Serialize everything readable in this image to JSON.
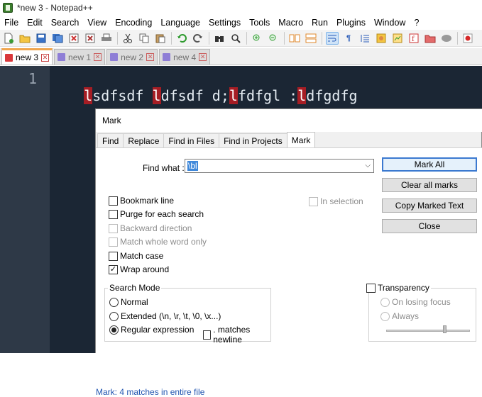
{
  "window": {
    "title": "*new 3 - Notepad++"
  },
  "menu": [
    "File",
    "Edit",
    "Search",
    "View",
    "Encoding",
    "Language",
    "Settings",
    "Tools",
    "Macro",
    "Run",
    "Plugins",
    "Window",
    "?"
  ],
  "tabs": [
    {
      "label": "new 3",
      "active": true
    },
    {
      "label": "new 1",
      "active": false
    },
    {
      "label": "new 2",
      "active": false
    },
    {
      "label": "new 4",
      "active": false
    }
  ],
  "editor": {
    "line_number": "1",
    "segments": [
      {
        "text": "l",
        "marked": true
      },
      {
        "text": "sdfsdf ",
        "marked": false
      },
      {
        "text": "l",
        "marked": true
      },
      {
        "text": "dfsdf d;",
        "marked": false
      },
      {
        "text": "l",
        "marked": true
      },
      {
        "text": "fdfgl :",
        "marked": false
      },
      {
        "text": "l",
        "marked": true
      },
      {
        "text": "dfgdfg",
        "marked": false
      }
    ]
  },
  "dialog": {
    "title": "Mark",
    "tabs": [
      "Find",
      "Replace",
      "Find in Files",
      "Find in Projects",
      "Mark"
    ],
    "find_what_label": "Find what :",
    "find_what_value": "\\bl",
    "buttons": {
      "mark_all": "Mark All",
      "clear_all_marks": "Clear all marks",
      "copy_marked_text": "Copy Marked Text",
      "close": "Close"
    },
    "options": {
      "bookmark_line": {
        "label": "Bookmark line",
        "checked": false
      },
      "purge": {
        "label": "Purge for each search",
        "checked": false
      },
      "backward": {
        "label": "Backward direction",
        "checked": false
      },
      "whole_word": {
        "label": "Match whole word only",
        "checked": false
      },
      "match_case": {
        "label": "Match case",
        "checked": false
      },
      "wrap_around": {
        "label": "Wrap around",
        "checked": true
      },
      "in_selection": {
        "label": "In selection",
        "checked": false
      }
    },
    "search_mode": {
      "title": "Search Mode",
      "normal": "Normal",
      "extended": "Extended (\\n, \\r, \\t, \\0, \\x...)",
      "regex": "Regular expression",
      "matches_newline": ". matches newline",
      "selected": "regex"
    },
    "transparency": {
      "label": "Transparency",
      "on_losing_focus": "On losing focus",
      "always": "Always"
    },
    "status": "Mark: 4 matches in entire file"
  }
}
